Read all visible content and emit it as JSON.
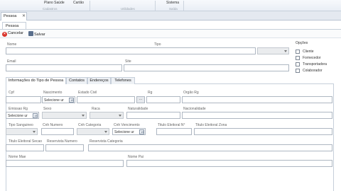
{
  "ribbon": {
    "buttons": [
      "Plano Saúde",
      "Cartão",
      "Sistema"
    ],
    "groups": [
      "Cadastros",
      "Utilidades",
      "Saída"
    ]
  },
  "document_tab": {
    "label": "Pessoa",
    "close": "✕"
  },
  "inner_tab": {
    "label": "Pessoa"
  },
  "toolbar": {
    "cancel_label": "Cancelar",
    "save_label": "Salvar"
  },
  "main_fields": {
    "nome": "Nome",
    "tipo": "Tipo",
    "email": "Email",
    "site": "Site"
  },
  "opcoes": {
    "title": "Opções",
    "items": [
      "Cliente",
      "Fornecedor",
      "Transportadora",
      "Colaborador"
    ]
  },
  "tabs": [
    "Informações do Tipo de Pessoa",
    "Contatos",
    "Endereços",
    "Telefones"
  ],
  "form": {
    "cpf": "Cpf",
    "nascimento": "Nascimento",
    "estado_civil": "Estado Civil",
    "rg": "Rg",
    "orgao_rg": "Orgão Rg",
    "emissao_rg": "Emissao Rg",
    "sexo": "Sexo",
    "raca": "Raca",
    "naturalidade": "Naturalidade",
    "nacionalidade": "Nacionalidade",
    "tipo_sanguineo": "Tipo Sanguineo",
    "cnh_numero": "Cnh Numero",
    "cnh_categoria": "Cnh Categoria",
    "cnh_vencimento": "Cnh Vencimento",
    "titulo_eleitoral_n": "Titulo Eleitoral N°",
    "titulo_eleitoral_zona": "Titulo Eleitoral Zona",
    "titulo_eleitoral_secao": "Titulo Eleitoral Secao",
    "reservista_numero": "Reservista Numero",
    "reservista_categoria": "Reservista Categoria",
    "nome_mae": "Nome Mae",
    "nome_pai": "Nome Pai",
    "date_placeholder": "Selecione ur",
    "ellipsis": "...",
    "calendar": "15"
  }
}
